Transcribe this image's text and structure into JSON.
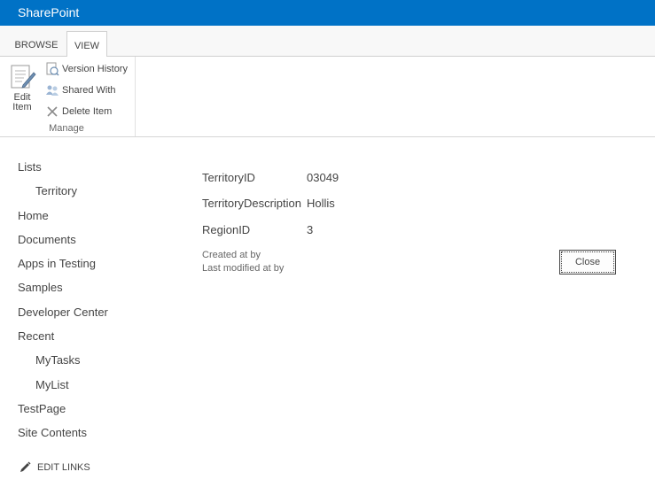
{
  "suite": {
    "title": "SharePoint"
  },
  "tabs": [
    {
      "label": "BROWSE"
    },
    {
      "label": "VIEW"
    }
  ],
  "ribbon": {
    "edit_item": "Edit\nItem",
    "version_history": "Version History",
    "shared_with": "Shared With",
    "delete_item": "Delete Item",
    "group_label": "Manage"
  },
  "nav": {
    "lists": "Lists",
    "territory": "Territory",
    "home": "Home",
    "documents": "Documents",
    "apps_in_testing": "Apps in Testing",
    "samples": "Samples",
    "developer_center": "Developer Center",
    "recent": "Recent",
    "mytasks": "MyTasks",
    "mylist": "MyList",
    "testpage": "TestPage",
    "site_contents": "Site Contents",
    "edit_links": "EDIT LINKS"
  },
  "item": {
    "fields": [
      {
        "label": "TerritoryID",
        "value": "03049"
      },
      {
        "label": "TerritoryDescription",
        "value": "Hollis"
      },
      {
        "label": "RegionID",
        "value": "3"
      }
    ],
    "created": "Created at by",
    "modified": "Last modified at by",
    "close_label": "Close"
  },
  "colors": {
    "suite_bar": "#0072c6",
    "text": "#444444"
  }
}
